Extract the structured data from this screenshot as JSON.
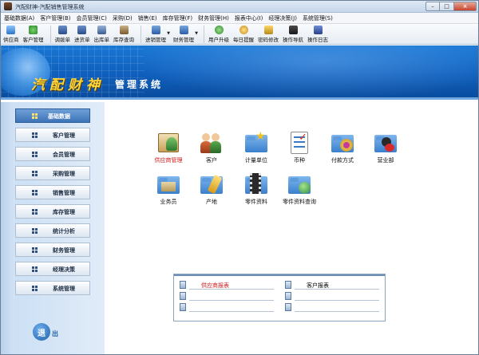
{
  "window": {
    "title": "汽配财神-汽配销售管理系统"
  },
  "menu": [
    "基础数据(A)",
    "客户管理(B)",
    "会员管理(C)",
    "采购(D)",
    "销售(E)",
    "库存管理(F)",
    "财务管理(H)",
    "报表中心(I)",
    "经理决策(J)",
    "系统管理(S)"
  ],
  "toolbar": {
    "supplier": "供应商",
    "customer": "客户管理",
    "transfer": "调拨单",
    "purchase_in": "进货单",
    "outbound": "出库单",
    "inventory_query": "库存查询",
    "sales_mgmt": "进销管理",
    "finance_mgmt": "财务管理",
    "upgrade": "用户升级",
    "daily_reminder": "每日提醒",
    "change_password": "密码修改",
    "guide": "操作导航",
    "log": "操作日志"
  },
  "banner": {
    "brand": "汽配财神",
    "subtitle": "管理系统"
  },
  "nav": [
    "基础数据",
    "客户管理",
    "会员管理",
    "采购管理",
    "销售管理",
    "库存管理",
    "统计分析",
    "财务管理",
    "经理决策",
    "系统管理"
  ],
  "exit": {
    "char": "退",
    "label": "出"
  },
  "modules": {
    "supplier": "供应商管理",
    "customer": "客户",
    "unit": "计量单位",
    "currency": "币种",
    "payment": "付款方式",
    "business_dept": "营业部",
    "salesperson": "业务员",
    "origin": "产地",
    "parts": "零件资料",
    "parts_query": "零件资料查询"
  },
  "reports": {
    "left_title": "供应商报表",
    "right_title": "客户报表"
  },
  "colors": {
    "accent_red": "#cc1a1a",
    "banner_blue": "#0f5fbd",
    "brand_yellow": "#ffd63a"
  }
}
